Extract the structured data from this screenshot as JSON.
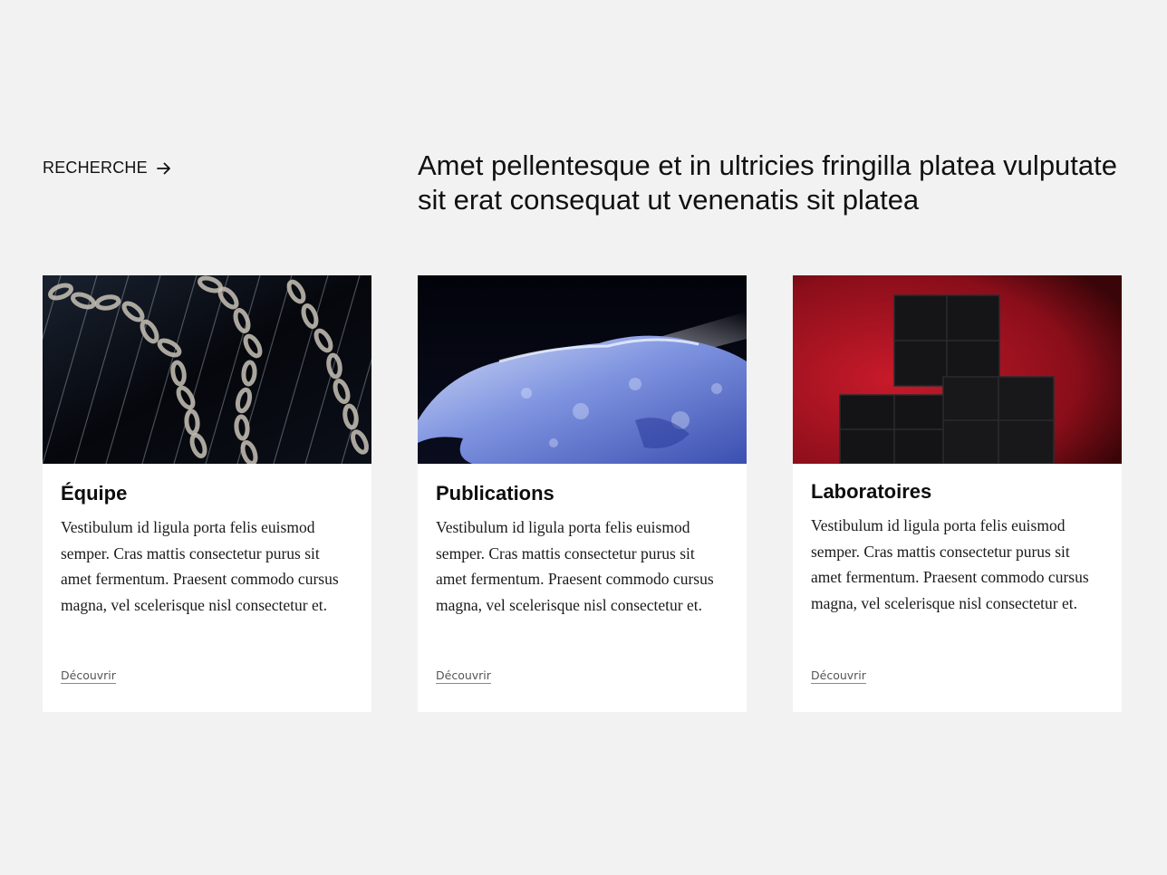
{
  "section": {
    "link_label": "RECHERCHE",
    "link_icon": "arrow-right-icon",
    "intro": "Amet pellentesque et in ultricies fringilla platea vulputate sit erat consequat ut venenatis sit platea"
  },
  "cards": [
    {
      "title": "Équipe",
      "text": "Vestibulum id ligula porta felis euismod semper. Cras mattis consectetur purus sit amet fermentum. Praesent commodo cursus magna, vel scelerisque nisl consectetur et.",
      "cta": "Découvrir",
      "image": "chains-image"
    },
    {
      "title": "Publications",
      "text": "Vestibulum id ligula porta felis euismod semper. Cras mattis consectetur purus sit amet fermentum. Praesent commodo cursus magna, vel scelerisque nisl consectetur et.",
      "cta": "Découvrir",
      "image": "ice-image"
    },
    {
      "title": "Laboratoires",
      "text": "Vestibulum id ligula porta felis euismod semper. Cras mattis consectetur purus sit amet fermentum. Praesent commodo cursus magna, vel scelerisque nisl consectetur et.",
      "cta": "Découvrir",
      "image": "cubes-image"
    }
  ],
  "colors": {
    "background": "#f2f2f2",
    "card": "#ffffff",
    "text": "#111111",
    "accent_red": "#b01020"
  }
}
